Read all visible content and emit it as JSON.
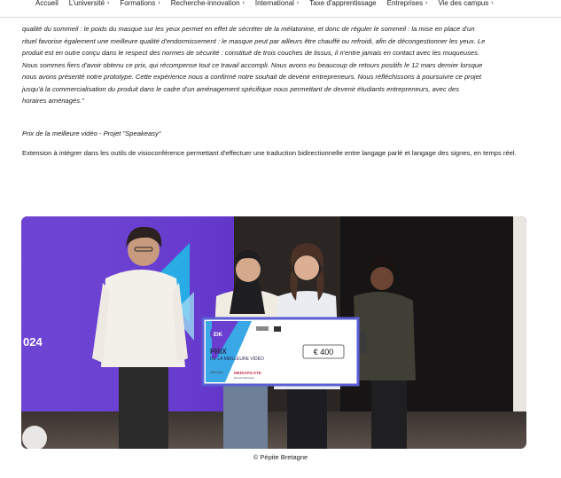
{
  "nav": {
    "items": [
      {
        "label": "Accueil",
        "chevron": false
      },
      {
        "label": "L'université",
        "chevron": true
      },
      {
        "label": "Formations",
        "chevron": true
      },
      {
        "label": "Recherche-innovation",
        "chevron": true
      },
      {
        "label": "International",
        "chevron": true
      },
      {
        "label": "Taxe d'apprentissage",
        "chevron": false
      },
      {
        "label": "Entreprises",
        "chevron": true
      },
      {
        "label": "Vie des campus",
        "chevron": true
      }
    ],
    "chevron_icon": "›"
  },
  "article": {
    "quote_lines": [
      "qualité du sommeil : le poids du masque sur les yeux permet en effet de sécréter de la mélatonine, et donc de réguler le sommeil : la mise en place d'un",
      "rituel favorise également une meilleure qualité d'endormissement : le masque peut par ailleurs être chauffé ou refroidi, afin de décongestionner les yeux. Le",
      "produit est en outre conçu dans le respect des normes de sécurité :  constitué de trois couches de tissus, il n'entre jamais en contact avec les muqueuses.",
      "Nous sommes fiers d'avoir obtenu ce prix, qui récompense tout ce travail accompli. Nous avons eu beaucoup de retours positifs le 12 mars dernier lorsque",
      "nous avons présenté notre prototype. Cette expérience nous a confirmé notre souhait de devenir entrepreneurs.  Nous réfléchissons à poursuivre ce projet",
      "jusqu'à la commercialisation du produit dans le cadre d'un aménagement spécifique nous permettant de devenir étudiants entrepreneurs, avec des",
      "horaires aménagés.\""
    ],
    "prize_heading": "Prix de la meilleure vidéo - Projet \"Speakeasy\"",
    "prize_description": "Extension à intégrer dans les outils de visioconférence permettant d'effectuer une traduction bidirectionnelle entre langage parlé et langage des signes, en temps réel."
  },
  "photo": {
    "banner_year": "024",
    "cheque": {
      "prize_line1": "PRIX",
      "prize_line2": "DE LA MEILLEURE VIDÉO",
      "amount": "€ 400",
      "offered_by": "offert par :",
      "sponsor": "MEDIAPILOTE",
      "sponsor_sub": "Rennes Métropole"
    },
    "colors": {
      "accent_purple": "#6a3fd0",
      "accent_cyan": "#22b8e8",
      "stage_dark": "#1d1b1a"
    }
  },
  "caption": "© Pépite Bretagne"
}
